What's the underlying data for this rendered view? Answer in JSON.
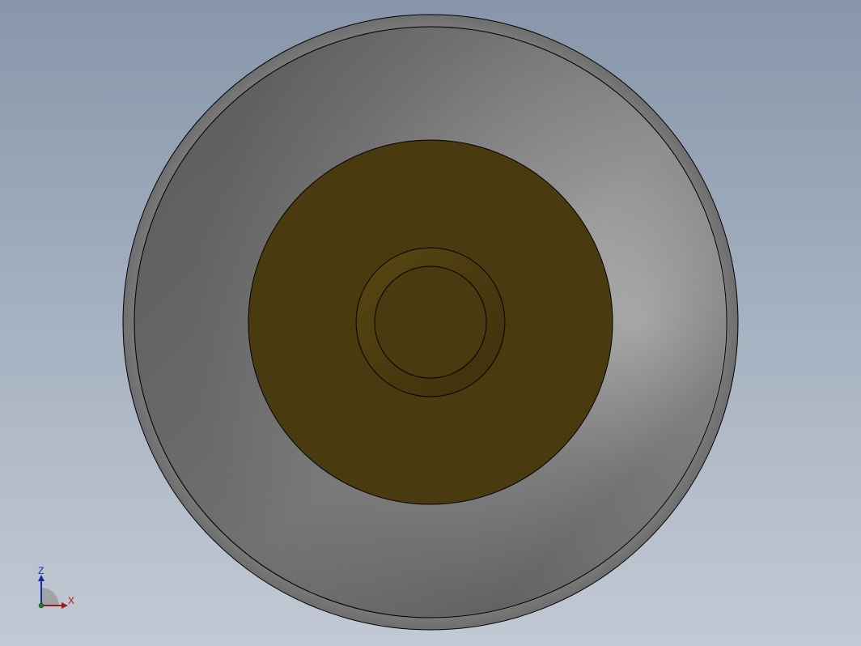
{
  "viewport": {
    "background_top": "#8796aa",
    "background_bottom": "#c2c9d4"
  },
  "model": {
    "outer_ring_color": "#7a7a7a",
    "face_color": "#4a3a0f",
    "boss_color": "#4a3a10",
    "edge_color": "#000000"
  },
  "triad": {
    "z_label": "Z",
    "x_label": "X",
    "z_color": "#1a2aa0",
    "x_color": "#a01a1a"
  }
}
